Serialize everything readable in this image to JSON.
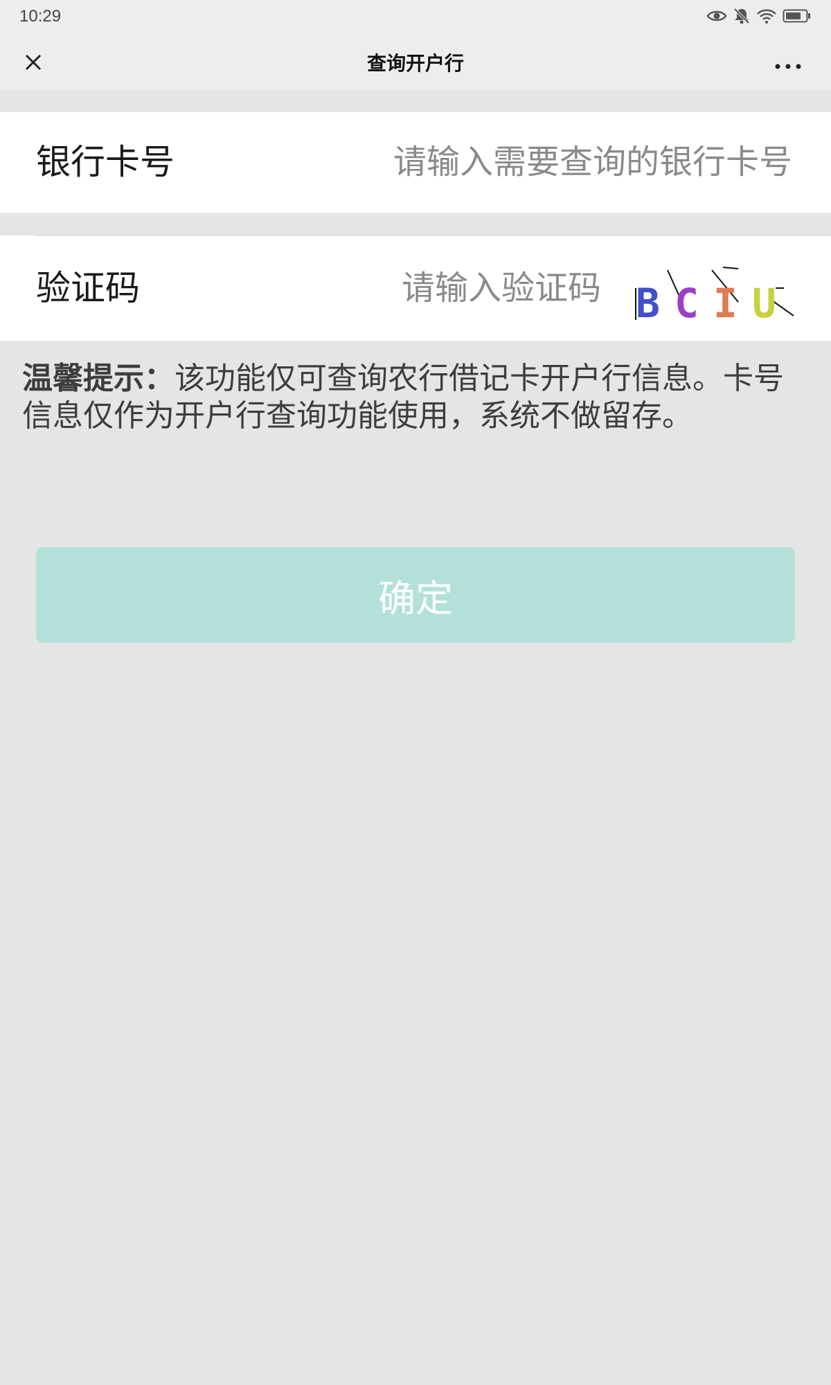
{
  "status_bar": {
    "time": "10:29",
    "icons": [
      "eye-icon",
      "bell-muted-icon",
      "wifi-icon",
      "battery-icon"
    ]
  },
  "nav": {
    "title": "查询开户行",
    "close_icon": "close-icon",
    "more_icon": "more-icon"
  },
  "card_row": {
    "label": "银行卡号",
    "placeholder": "请输入需要查询的银行卡号",
    "value": ""
  },
  "captcha_row": {
    "label": "验证码",
    "placeholder": "请输入验证码",
    "value": "",
    "captcha_text": "BCIU"
  },
  "tip": {
    "title": "温馨提示：",
    "text": "该功能仅可查询农行借记卡开户行信息。卡号信息仅作为开户行查询功能使用，系统不做留存。"
  },
  "confirm_button": {
    "label": "确定"
  },
  "colors": {
    "background": "#e5e5e5",
    "nav_background": "#ededed",
    "button_disabled": "#b3e1da",
    "placeholder": "#8a8a8a"
  }
}
